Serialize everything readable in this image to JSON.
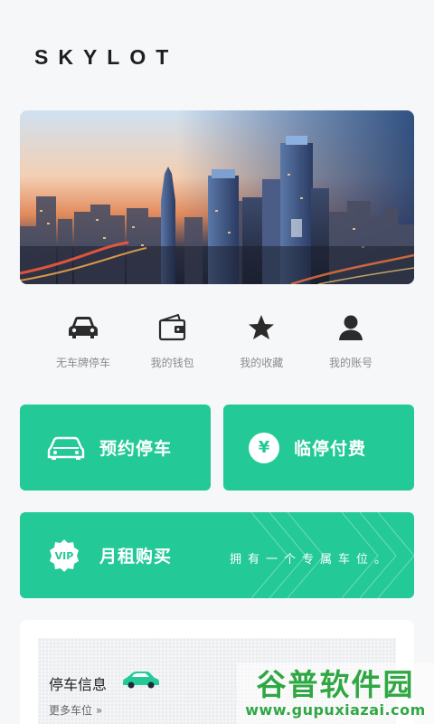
{
  "app": {
    "brand": "SKYLOT"
  },
  "banner": {
    "alt": "city-skyline-banner"
  },
  "quick_actions": [
    {
      "id": "no-plate",
      "icon": "car-icon",
      "label": "无车牌停车"
    },
    {
      "id": "wallet",
      "icon": "wallet-icon",
      "label": "我的钱包"
    },
    {
      "id": "favorites",
      "icon": "star-icon",
      "label": "我的收藏"
    },
    {
      "id": "account",
      "icon": "user-icon",
      "label": "我的账号"
    }
  ],
  "cards": {
    "reserve": {
      "icon": "car-outline-icon",
      "title": "预约停车"
    },
    "pay": {
      "icon": "yen-icon",
      "icon_glyph": "¥",
      "title": "临停付费"
    },
    "monthly": {
      "icon": "vip-badge-icon",
      "badge": "VIP",
      "title": "月租购买",
      "slogan": "拥有一个专属车位。"
    }
  },
  "parking_info": {
    "title": "停车信息",
    "more": "更多车位 »"
  },
  "watermark": {
    "title": "谷普软件园",
    "url": "www.gupuxiazai.com"
  },
  "colors": {
    "accent": "#23c997",
    "background": "#f6f7f9",
    "icon_dark": "#2b2b2b"
  }
}
